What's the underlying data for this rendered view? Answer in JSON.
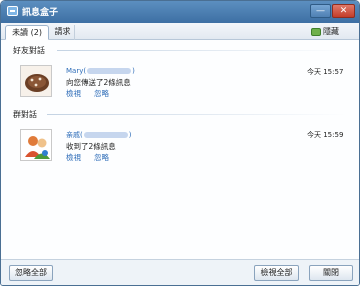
{
  "window": {
    "title": "訊息盒子"
  },
  "titlebar": {
    "min_label": "—",
    "close_label": "✕"
  },
  "tabs": [
    {
      "label": "未讀 (2)"
    },
    {
      "label": "請求"
    }
  ],
  "hide": {
    "label": "隱藏"
  },
  "sections": {
    "friends": {
      "label": "好友對話"
    },
    "groups": {
      "label": "群對話"
    }
  },
  "items": [
    {
      "name": "Mary(",
      "name_suffix": ")",
      "time": "今天 15:57",
      "message": "向您傳送了2條訊息",
      "actions": {
        "view": "檢視",
        "ignore": "忽略"
      }
    },
    {
      "name": "亲戚(",
      "name_suffix": ")",
      "time": "今天 15:59",
      "message": "收到了2條訊息",
      "actions": {
        "view": "檢視",
        "ignore": "忽略"
      }
    }
  ],
  "footer": {
    "ignore_all": "忽略全部",
    "view_all": "檢視全部",
    "close": "關閉"
  }
}
